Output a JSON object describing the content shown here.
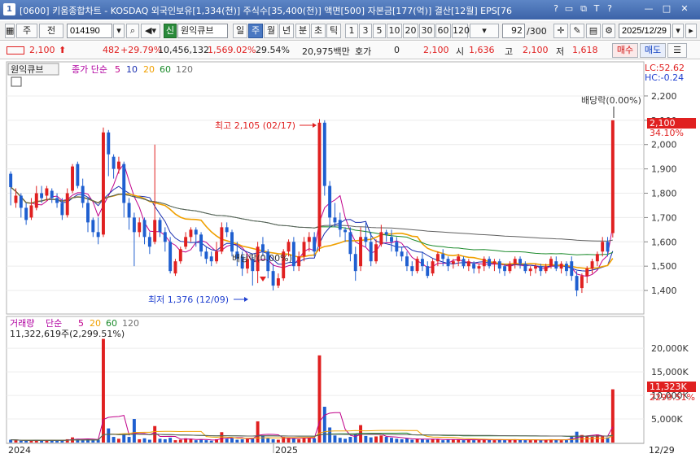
{
  "window": {
    "number": "1",
    "title": "[0600] 키움종합차트 - KOSDAQ 외국인보유[1,334(천)] 주식수[35,400(천)] 액면[500] 자본금[177(억)] 결산[12월] EPS[76",
    "controls": [
      "?",
      "□",
      "⧉",
      "T",
      "?",
      "—",
      "□",
      "✕"
    ]
  },
  "toolbar": {
    "period_button": "주",
    "all_button": "전",
    "stock_code": "014190",
    "credit_badge": "신",
    "stock_name": "원익큐브",
    "period_tabs": [
      "일",
      "주",
      "월",
      "년",
      "분",
      "초",
      "틱"
    ],
    "selected_period": "주",
    "intervals": [
      "1",
      "3",
      "5",
      "10",
      "20",
      "30",
      "60",
      "120"
    ],
    "count_value": "92",
    "count_total": "/300",
    "date_value": "2025/12/29"
  },
  "quote": {
    "price": "2,100",
    "change": "482",
    "change_rate": "+29.79%",
    "volume": "10,456,132",
    "volume_rate": "1,569.02%",
    "turnover": "29.54%",
    "amount": "20,975백만",
    "ask_label": "호가",
    "ask_value": "0",
    "ask_price": "2,100",
    "open_label": "시",
    "open": "1,636",
    "high_label": "고",
    "high": "2,100",
    "low_label": "저",
    "low": "1,618",
    "buy_button": "매수",
    "sell_button": "매도",
    "trend_icon": "line-chart-icon"
  },
  "price_panel": {
    "stock_label": "원익큐브",
    "ma_label": "종가 단순",
    "ma_periods": [
      "5",
      "10",
      "20",
      "60",
      "120"
    ],
    "lc": "LC:52.62",
    "hc": "HC:-0.24",
    "annotations": {
      "dividend_top": "배당락(0.00%)",
      "high_note": "최고 2,105 (02/17)",
      "low_note": "최저 1,376 (12/09)",
      "dividend_mid": "배당락(0.00%)"
    },
    "current_price_tag": "2,100",
    "current_pct_tag": "34.10%"
  },
  "volume_panel": {
    "label": "거래량",
    "ma_label": "단순",
    "ma_periods": [
      "5",
      "20",
      "60",
      "120"
    ],
    "info": "11,322,619주(2,299.51%)",
    "current_tag": "11,323K",
    "current_pct_tag": "2299.51%"
  },
  "x_axis": {
    "labels": [
      "2024",
      "2025"
    ],
    "end_label": "12/29"
  },
  "colors": {
    "up": "#e02020",
    "down": "#1f5fd0",
    "ma5": "#c0008a",
    "ma10": "#1a2fb0",
    "ma20": "#f0a000",
    "ma60": "#1a8a2a",
    "ma120": "#606060",
    "accent": "#3c63a8"
  },
  "chart_data": [
    {
      "type": "candlestick",
      "title": "원익큐브 주봉",
      "ylabel": "",
      "y_ticks": [
        1400,
        1500,
        1600,
        1700,
        1800,
        1900,
        2000,
        2100,
        2200
      ],
      "ylim": [
        1330,
        2250
      ],
      "high_marker": {
        "value": 2105,
        "date": "02/17"
      },
      "low_marker": {
        "value": 1376,
        "date": "12/09"
      },
      "last": 2100,
      "candles": [
        [
          1880,
          1825,
          1890,
          1750
        ],
        [
          1760,
          1790,
          1820,
          1740
        ],
        [
          1790,
          1740,
          1800,
          1700
        ],
        [
          1740,
          1690,
          1760,
          1670
        ],
        [
          1700,
          1750,
          1780,
          1690
        ],
        [
          1740,
          1800,
          1830,
          1730
        ],
        [
          1800,
          1780,
          1830,
          1760
        ],
        [
          1790,
          1820,
          1830,
          1770
        ],
        [
          1810,
          1780,
          1820,
          1760
        ],
        [
          1780,
          1760,
          1800,
          1740
        ],
        [
          1760,
          1710,
          1780,
          1690
        ],
        [
          1710,
          1800,
          1820,
          1700
        ],
        [
          1810,
          1910,
          1920,
          1800
        ],
        [
          1920,
          1830,
          1930,
          1820
        ],
        [
          1830,
          1760,
          1860,
          1740
        ],
        [
          1760,
          1680,
          1780,
          1640
        ],
        [
          1690,
          1640,
          1700,
          1620
        ],
        [
          1640,
          1620,
          1700,
          1590
        ],
        [
          1630,
          2050,
          2070,
          1620
        ],
        [
          2050,
          1960,
          2060,
          1870
        ],
        [
          1950,
          1900,
          1960,
          1860
        ],
        [
          1900,
          1930,
          1950,
          1880
        ],
        [
          1920,
          1760,
          1930,
          1700
        ],
        [
          1760,
          1700,
          1780,
          1650
        ],
        [
          1700,
          1640,
          1720,
          1500
        ],
        [
          1640,
          1680,
          1700,
          1620
        ],
        [
          1690,
          1620,
          1700,
          1590
        ],
        [
          1620,
          1580,
          1640,
          1550
        ],
        [
          1600,
          1690,
          2000,
          1590
        ],
        [
          1690,
          1640,
          1700,
          1620
        ],
        [
          1640,
          1600,
          1660,
          1560
        ],
        [
          1600,
          1480,
          1620,
          1470
        ],
        [
          1470,
          1520,
          1530,
          1460
        ],
        [
          1520,
          1570,
          1580,
          1510
        ],
        [
          1580,
          1620,
          1640,
          1570
        ],
        [
          1620,
          1650,
          1660,
          1600
        ],
        [
          1650,
          1630,
          1660,
          1580
        ],
        [
          1630,
          1560,
          1640,
          1540
        ],
        [
          1560,
          1530,
          1580,
          1510
        ],
        [
          1540,
          1520,
          1560,
          1500
        ],
        [
          1520,
          1560,
          1600,
          1510
        ],
        [
          1560,
          1660,
          1680,
          1550
        ],
        [
          1660,
          1640,
          1680,
          1620
        ],
        [
          1640,
          1560,
          1650,
          1540
        ],
        [
          1560,
          1530,
          1600,
          1500
        ],
        [
          1540,
          1490,
          1560,
          1460
        ],
        [
          1490,
          1530,
          1540,
          1470
        ],
        [
          1530,
          1480,
          1540,
          1420
        ],
        [
          1480,
          1580,
          1600,
          1430
        ],
        [
          1590,
          1560,
          1620,
          1540
        ],
        [
          1560,
          1480,
          1570,
          1450
        ],
        [
          1480,
          1420,
          1510,
          1400
        ],
        [
          1420,
          1450,
          1470,
          1410
        ],
        [
          1450,
          1560,
          1570,
          1440
        ],
        [
          1560,
          1600,
          1610,
          1540
        ],
        [
          1600,
          1500,
          1620,
          1480
        ],
        [
          1500,
          1540,
          1560,
          1480
        ],
        [
          1540,
          1600,
          1620,
          1520
        ],
        [
          1600,
          1620,
          1640,
          1560
        ],
        [
          1620,
          1560,
          1640,
          1540
        ],
        [
          1580,
          2090,
          2105,
          1560
        ],
        [
          2090,
          1830,
          2100,
          1790
        ],
        [
          1830,
          1700,
          1850,
          1660
        ],
        [
          1700,
          1680,
          1760,
          1660
        ],
        [
          1690,
          1650,
          1720,
          1620
        ],
        [
          1650,
          1640,
          1660,
          1600
        ],
        [
          1640,
          1550,
          1660,
          1520
        ],
        [
          1550,
          1480,
          1580,
          1440
        ],
        [
          1500,
          1620,
          1660,
          1480
        ],
        [
          1620,
          1600,
          1680,
          1580
        ],
        [
          1600,
          1520,
          1640,
          1500
        ],
        [
          1520,
          1590,
          1610,
          1510
        ],
        [
          1590,
          1640,
          1670,
          1580
        ],
        [
          1640,
          1630,
          1650,
          1600
        ],
        [
          1620,
          1600,
          1650,
          1560
        ],
        [
          1600,
          1560,
          1620,
          1540
        ],
        [
          1560,
          1540,
          1580,
          1520
        ],
        [
          1540,
          1500,
          1560,
          1480
        ],
        [
          1500,
          1480,
          1520,
          1460
        ],
        [
          1480,
          1530,
          1540,
          1470
        ],
        [
          1530,
          1500,
          1560,
          1480
        ],
        [
          1500,
          1460,
          1520,
          1450
        ],
        [
          1470,
          1520,
          1530,
          1460
        ],
        [
          1520,
          1550,
          1560,
          1500
        ],
        [
          1550,
          1530,
          1570,
          1500
        ],
        [
          1530,
          1500,
          1540,
          1480
        ],
        [
          1510,
          1520,
          1530,
          1490
        ],
        [
          1520,
          1540,
          1550,
          1500
        ],
        [
          1530,
          1500,
          1540,
          1490
        ],
        [
          1500,
          1520,
          1530,
          1480
        ],
        [
          1510,
          1490,
          1520,
          1470
        ],
        [
          1490,
          1500,
          1510,
          1470
        ],
        [
          1500,
          1530,
          1540,
          1480
        ],
        [
          1530,
          1500,
          1540,
          1490
        ],
        [
          1510,
          1520,
          1530,
          1480
        ],
        [
          1520,
          1490,
          1530,
          1470
        ],
        [
          1500,
          1480,
          1510,
          1460
        ],
        [
          1480,
          1510,
          1520,
          1470
        ],
        [
          1510,
          1530,
          1540,
          1490
        ],
        [
          1530,
          1510,
          1540,
          1490
        ],
        [
          1510,
          1480,
          1520,
          1470
        ],
        [
          1480,
          1490,
          1500,
          1460
        ],
        [
          1490,
          1500,
          1510,
          1470
        ],
        [
          1500,
          1480,
          1510,
          1460
        ],
        [
          1480,
          1500,
          1510,
          1470
        ],
        [
          1500,
          1530,
          1540,
          1490
        ],
        [
          1520,
          1490,
          1540,
          1480
        ],
        [
          1490,
          1510,
          1520,
          1470
        ],
        [
          1510,
          1480,
          1520,
          1460
        ],
        [
          1520,
          1460,
          1540,
          1440
        ],
        [
          1460,
          1400,
          1480,
          1376
        ],
        [
          1410,
          1460,
          1470,
          1390
        ],
        [
          1460,
          1490,
          1500,
          1430
        ],
        [
          1490,
          1520,
          1530,
          1470
        ],
        [
          1520,
          1550,
          1560,
          1500
        ],
        [
          1560,
          1600,
          1620,
          1540
        ],
        [
          1600,
          1560,
          1620,
          1540
        ],
        [
          1636,
          2100,
          2100,
          1618
        ]
      ],
      "volume": [
        0.6,
        0.5,
        0.4,
        0.4,
        0.5,
        0.6,
        0.4,
        0.5,
        0.5,
        0.4,
        0.5,
        0.7,
        1.1,
        0.8,
        0.6,
        0.7,
        0.5,
        0.6,
        22.0,
        3.0,
        1.2,
        0.8,
        1.8,
        1.2,
        5.0,
        0.7,
        0.9,
        0.6,
        3.5,
        0.8,
        0.7,
        1.0,
        0.5,
        0.6,
        0.9,
        0.8,
        0.5,
        0.6,
        0.5,
        0.4,
        0.7,
        2.2,
        0.8,
        0.9,
        0.6,
        0.7,
        0.8,
        1.0,
        4.5,
        1.5,
        0.9,
        0.7,
        0.6,
        1.2,
        1.0,
        0.9,
        0.7,
        1.1,
        1.0,
        0.9,
        18.5,
        7.6,
        3.2,
        1.5,
        1.0,
        0.8,
        1.2,
        1.9,
        3.7,
        1.4,
        1.1,
        1.3,
        1.5,
        1.2,
        1.0,
        0.8,
        0.7,
        0.9,
        0.6,
        0.8,
        0.7,
        0.6,
        0.8,
        0.7,
        0.5,
        0.6,
        0.6,
        0.7,
        0.5,
        0.6,
        0.5,
        0.6,
        0.7,
        0.6,
        0.5,
        0.6,
        0.5,
        0.6,
        0.7,
        0.6,
        0.5,
        0.5,
        0.6,
        0.5,
        0.6,
        0.7,
        0.6,
        0.5,
        0.6,
        1.2,
        2.3,
        1.6,
        1.4,
        1.2,
        1.7,
        1.3,
        1.1,
        11.3
      ],
      "volume_unit": "K",
      "volume_y_ticks": [
        5000,
        10000,
        15000,
        20000
      ]
    }
  ]
}
